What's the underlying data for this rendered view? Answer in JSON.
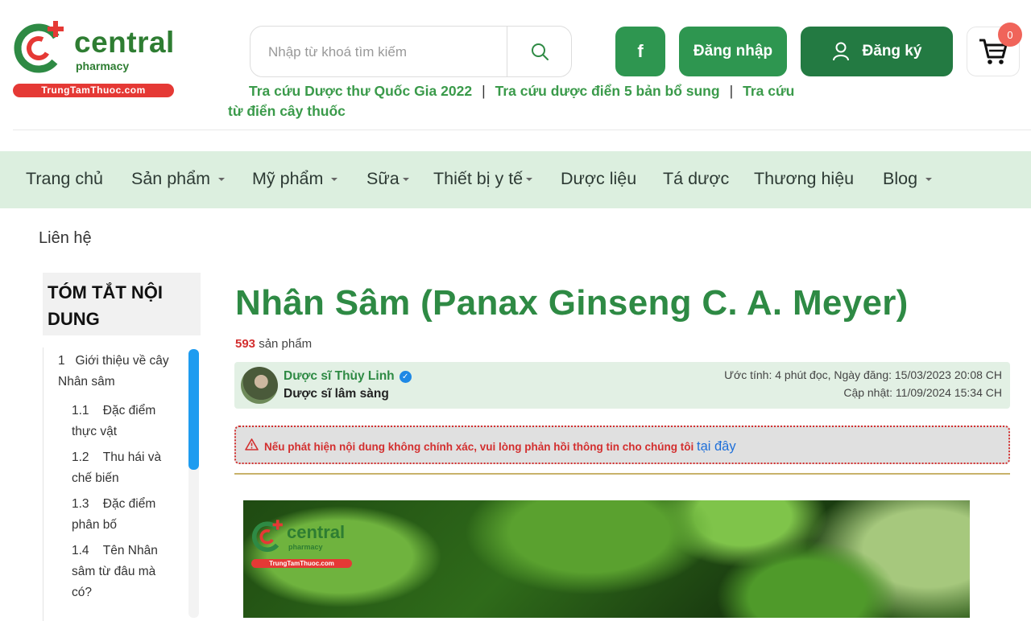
{
  "brand": {
    "name": "central",
    "sub": "pharmacy",
    "site": "TrungTamThuoc.com"
  },
  "search": {
    "placeholder": "Nhập từ khoá tìm kiếm"
  },
  "header": {
    "facebook_label": "f",
    "login_label": "Đăng nhập",
    "register_label": "Đăng ký",
    "cart_count": "0"
  },
  "quick_links": [
    "Tra cứu Dược thư Quốc Gia 2022",
    "Tra cứu dược điển 5 bản bổ sung",
    "Tra cứu từ điển cây thuốc"
  ],
  "nav": {
    "items": [
      {
        "label": "Trang chủ",
        "dropdown": false
      },
      {
        "label": "Sản phẩm",
        "dropdown": true
      },
      {
        "label": "Mỹ phẩm",
        "dropdown": true
      },
      {
        "label": "Sữa",
        "dropdown": true
      },
      {
        "label": "Thiết bị y tế",
        "dropdown": true
      },
      {
        "label": "Dược liệu",
        "dropdown": false
      },
      {
        "label": "Tá dược",
        "dropdown": false
      },
      {
        "label": "Thương hiệu",
        "dropdown": false
      },
      {
        "label": "Blog",
        "dropdown": true
      }
    ],
    "contact": "Liên hệ"
  },
  "toc": {
    "title": "TÓM TẮT NỘI DUNG",
    "items": [
      {
        "num": "1",
        "label": "Giới thiệu về cây Nhân sâm"
      },
      {
        "num": "1.1",
        "label": "Đặc điểm thực vật"
      },
      {
        "num": "1.2",
        "label": "Thu hái và chế biến"
      },
      {
        "num": "1.3",
        "label": "Đặc điểm phân bố"
      },
      {
        "num": "1.4",
        "label": "Tên Nhân sâm từ đâu mà có?"
      }
    ]
  },
  "article": {
    "title": "Nhân Sâm (Panax Ginseng C. A. Meyer)",
    "product_count": "593",
    "product_count_suffix": "sản phẩm",
    "author_name": "Dược sĩ Thùy Linh",
    "author_role": "Dược sĩ lâm sàng",
    "meta_estimate": "Ước tính: 4 phút đọc, Ngày đăng: 15/03/2023 20:08 CH",
    "meta_updated": "Cập nhật: 11/09/2024 15:34 CH",
    "alert_text": "Nếu phát hiện nội dung không chính xác, vui lòng phản hồi thông tin cho chúng tôi",
    "alert_link": "tại đây"
  },
  "colors": {
    "brand_green": "#2e8a44",
    "nav_bg": "#dcefdf",
    "alert_red": "#d32f2f",
    "link_blue": "#1e6fd9",
    "toc_scroll": "#1e9cf0"
  }
}
